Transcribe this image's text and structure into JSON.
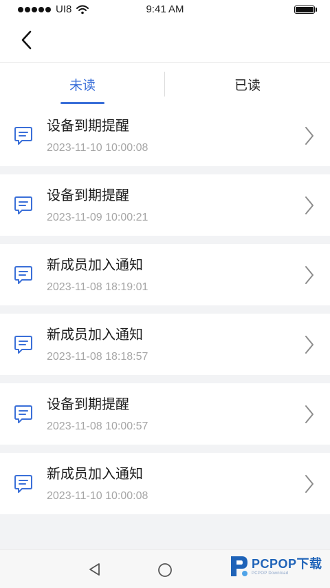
{
  "status_bar": {
    "carrier": "UI8",
    "time": "9:41 AM"
  },
  "nav": {
    "back_icon": "chevron-left-icon"
  },
  "tabs": [
    {
      "label": "未读",
      "active": true
    },
    {
      "label": "已读",
      "active": false
    }
  ],
  "colors": {
    "accent": "#3a6fd8",
    "background": "#f2f3f5",
    "secondary_text": "#a6a6a6"
  },
  "messages": [
    {
      "title": "设备到期提醒",
      "time": "2023-11-10 10:00:08",
      "icon": "message-icon"
    },
    {
      "title": "设备到期提醒",
      "time": "2023-11-09 10:00:21",
      "icon": "message-icon"
    },
    {
      "title": "新成员加入通知",
      "time": "2023-11-08 18:19:01",
      "icon": "message-icon"
    },
    {
      "title": "新成员加入通知",
      "time": "2023-11-08 18:18:57",
      "icon": "message-icon"
    },
    {
      "title": "设备到期提醒",
      "time": "2023-11-08 10:00:57",
      "icon": "message-icon"
    },
    {
      "title": "新成员加入通知",
      "time": "2023-11-10 10:00:08",
      "icon": "message-icon"
    }
  ],
  "watermark": {
    "text": "PCPOP下载",
    "subtext": "PCPOP Download"
  }
}
